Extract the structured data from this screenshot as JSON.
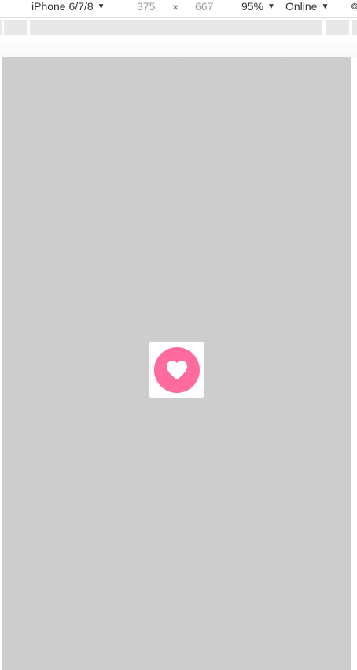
{
  "toolbar": {
    "device": "iPhone 6/7/8",
    "width": "375",
    "times": "×",
    "height": "667",
    "zoom": "95%",
    "throttling": "Online",
    "dropdown_arrow": "▼"
  },
  "like_widget": {
    "icon": "heart-icon",
    "circle_color": "#ff6b9f",
    "card_color": "#ffffff"
  },
  "colors": {
    "viewport_bg": "#cdcdcd"
  }
}
